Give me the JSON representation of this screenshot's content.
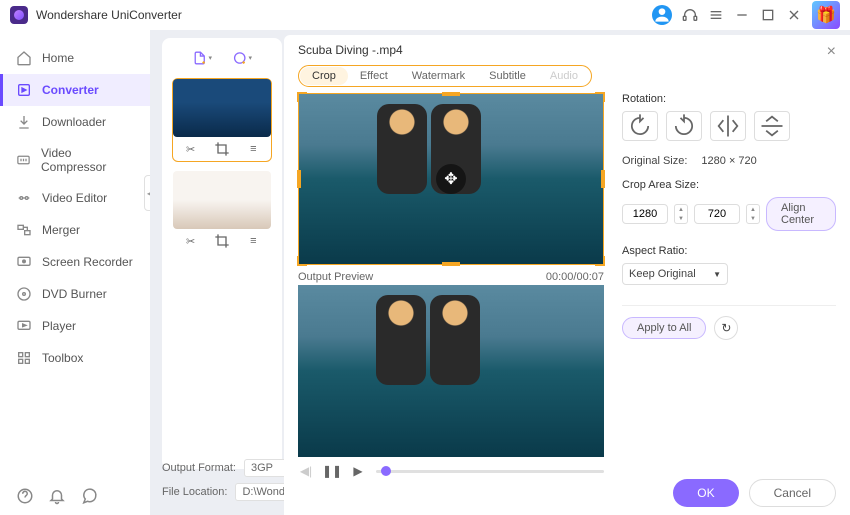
{
  "app_title": "Wondershare UniConverter",
  "sidebar": {
    "items": [
      {
        "icon": "home",
        "label": "Home"
      },
      {
        "icon": "converter",
        "label": "Converter"
      },
      {
        "icon": "download",
        "label": "Downloader"
      },
      {
        "icon": "compress",
        "label": "Video Compressor"
      },
      {
        "icon": "editor",
        "label": "Video Editor"
      },
      {
        "icon": "merger",
        "label": "Merger"
      },
      {
        "icon": "recorder",
        "label": "Screen Recorder"
      },
      {
        "icon": "dvd",
        "label": "DVD Burner"
      },
      {
        "icon": "player",
        "label": "Player"
      },
      {
        "icon": "toolbox",
        "label": "Toolbox"
      }
    ]
  },
  "output_format": {
    "label": "Output Format:",
    "value": "3GP"
  },
  "file_location": {
    "label": "File Location:",
    "value": "D:\\Wonders"
  },
  "editor": {
    "filename": "Scuba Diving -.mp4",
    "tabs": [
      "Crop",
      "Effect",
      "Watermark",
      "Subtitle",
      "Audio"
    ],
    "output_preview_label": "Output Preview",
    "timecode": "00:00/00:07",
    "rotation_label": "Rotation:",
    "original_size_label": "Original Size:",
    "original_size_value": "1280 × 720",
    "crop_area_label": "Crop Area Size:",
    "crop_w": "1280",
    "crop_h": "720",
    "align_center": "Align Center",
    "aspect_label": "Aspect Ratio:",
    "aspect_value": "Keep Original",
    "apply_all": "Apply to All",
    "ok": "OK",
    "cancel": "Cancel"
  }
}
